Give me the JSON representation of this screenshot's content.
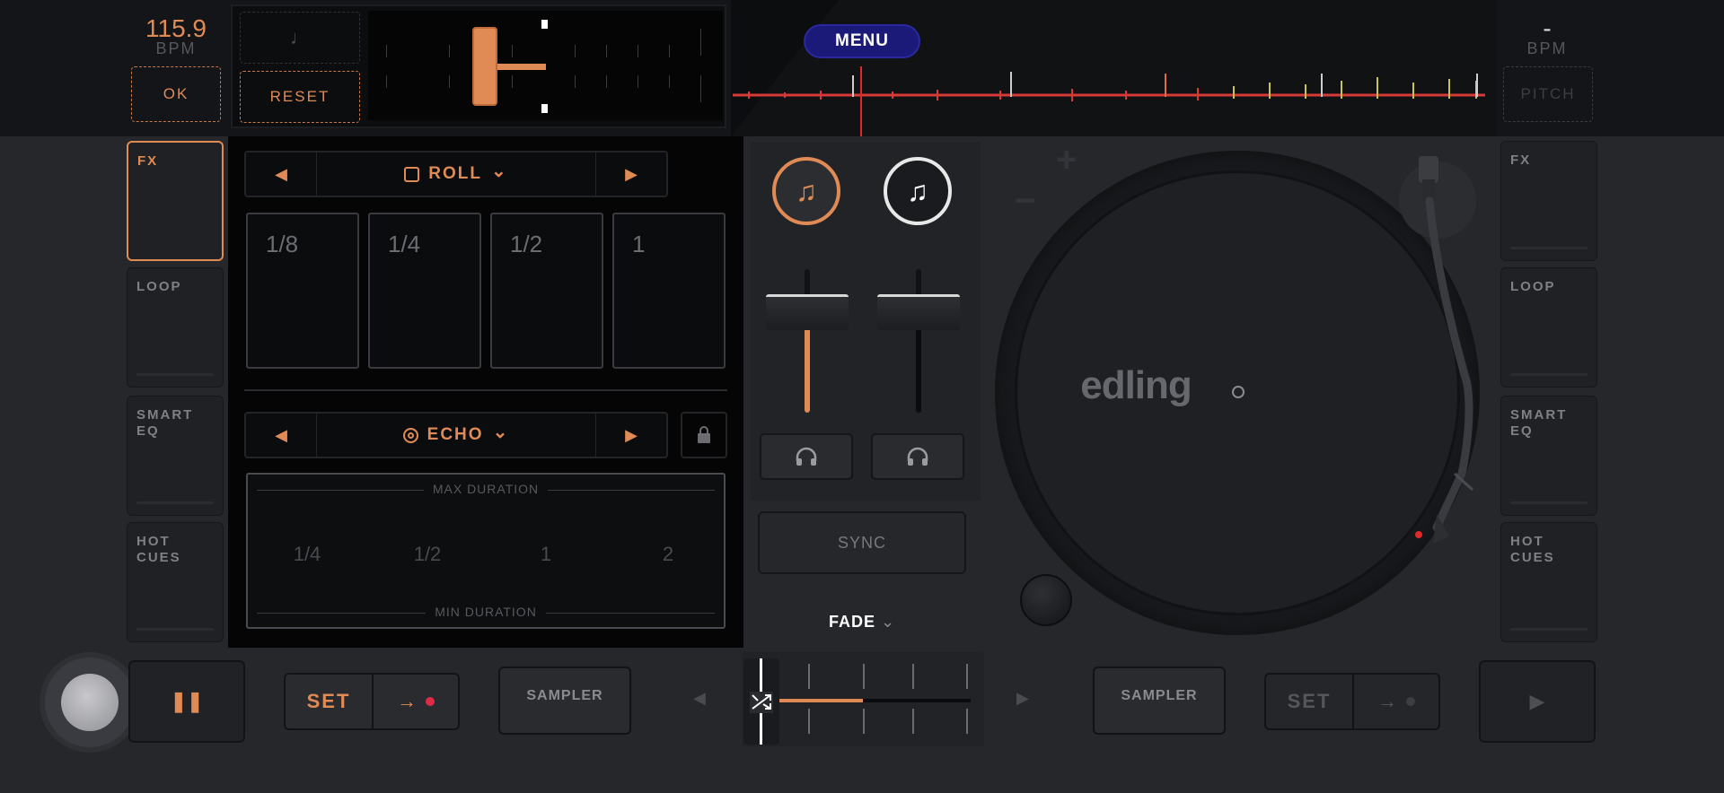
{
  "deck_left": {
    "bpm_value": "115.9",
    "bpm_label": "BPM",
    "ok_label": "OK",
    "reset_label": "RESET",
    "note_icon": "♩",
    "side_buttons": [
      "FX",
      "LOOP",
      "SMART\nEQ",
      "HOT\nCUES"
    ],
    "active_side": "FX",
    "pause_icon": "❚❚",
    "set_label": "SET",
    "set_arrow": "→",
    "sampler_label": "SAMPLER"
  },
  "deck_right": {
    "bpm_value": "-",
    "bpm_label": "BPM",
    "pitch_label": "PITCH",
    "side_buttons": [
      "FX",
      "LOOP",
      "SMART\nEQ",
      "HOT\nCUES"
    ],
    "play_icon": "▶",
    "set_label": "SET",
    "set_arrow": "→",
    "sampler_label": "SAMPLER"
  },
  "menu_label": "MENU",
  "fx_panel": {
    "roll": {
      "prev_icon": "◀",
      "next_icon": "▶",
      "label": "ROLL",
      "chevron": "⌄",
      "pads": [
        "1/8",
        "1/4",
        "1/2",
        "1"
      ]
    },
    "echo": {
      "prev_icon": "◀",
      "next_icon": "▶",
      "label": "ECHO",
      "chevron": "⌄",
      "max_caption": "MAX DURATION",
      "min_caption": "MIN DURATION",
      "values": [
        "1/4",
        "1/2",
        "1",
        "2"
      ]
    }
  },
  "mixer": {
    "track_icon": "♫",
    "headphone_icon": "🎧",
    "sync_label": "SYNC",
    "fade_label": "FADE",
    "fade_chevron": "⌄",
    "crossfader_left_arrow": "◀",
    "crossfader_right_arrow": "▶",
    "left_volume_level": 0.7,
    "right_volume_level": 0.7,
    "crossfader_position": 0.0
  },
  "turntable": {
    "logo": "edling",
    "plus_icon": "+",
    "minus_icon": "−"
  },
  "colors": {
    "accent": "#e08a55",
    "menu_bg": "#1b1a78",
    "waveform_red": "#d83a3a",
    "waveform_yellow": "#c9c25a"
  }
}
